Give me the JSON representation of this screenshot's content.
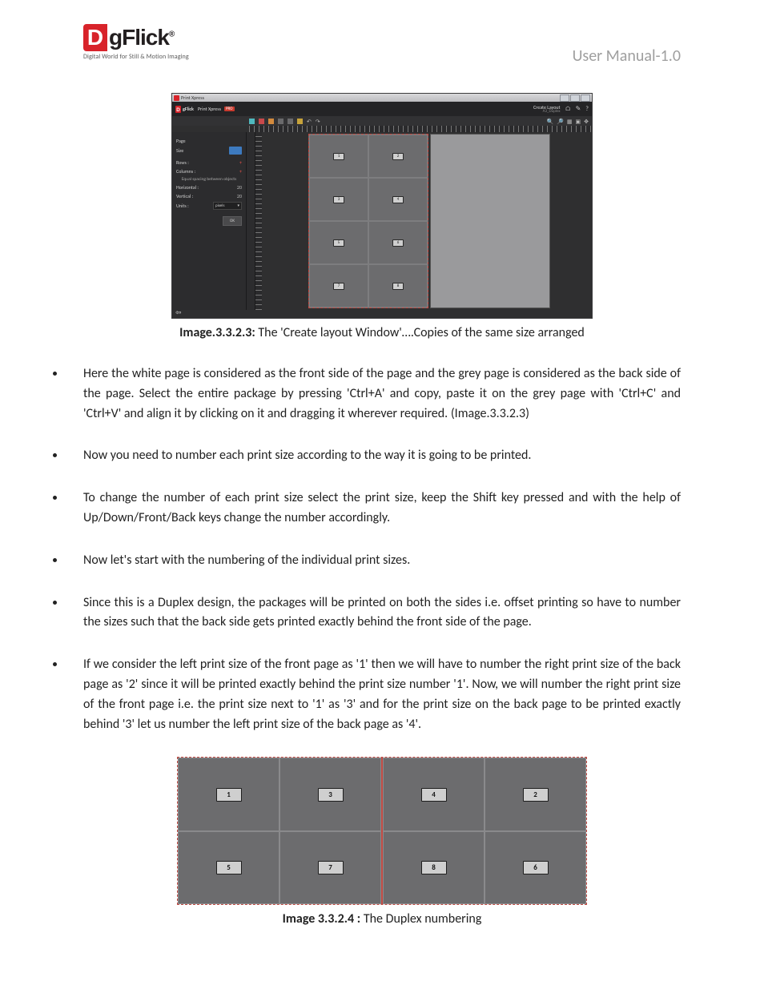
{
  "header": {
    "logo_d": "D",
    "logo_rest": "gFlick",
    "logo_reg": "®",
    "logo_tagline": "Digital World for Still & Motion Imaging",
    "right_text": "User Manual-1.0"
  },
  "fig1": {
    "titlebar_text": "Print Xpress",
    "brand_d": "D",
    "brand_text": "gFlick",
    "product": "Print Xpress",
    "pro_badge": "PRO",
    "create_layout": "Create Layout",
    "layout_name": "A3_Duplex",
    "side": {
      "size_label": "Size",
      "page_label": "Page",
      "rows_label": "Rows :",
      "rows_val": "",
      "cols_label": "Columns :",
      "cols_val": "",
      "spacing_label": "Equal spacing between objects",
      "horiz_label": "Horizontal :",
      "horiz_val": "20",
      "vert_label": "Vertical :",
      "vert_val": "20",
      "units_label": "Units :",
      "units_val": "pixels",
      "ok": "OK"
    },
    "cells": [
      "1",
      "2",
      "3",
      "4",
      "5",
      "6",
      "7",
      "8"
    ],
    "caption_b": "Image.3.3.2.3:",
    "caption_rest": " The 'Create layout Window'….Copies of the same size arranged"
  },
  "bullets": [
    "Here the white page is considered as the front side of the page and the grey page is considered as the back side of the page. Select the entire package by pressing 'Ctrl+A' and copy, paste it on the grey page with 'Ctrl+C' and 'Ctrl+V' and align it by clicking on it and dragging it wherever required. (Image.3.3.2.3)",
    "Now you need to number each print size according to the way it is going to be printed.",
    "To change the number of each print size select the print size, keep the Shift key pressed and with the help of Up/Down/Front/Back keys change the number accordingly.",
    "Now let's start with the numbering of the individual print sizes.",
    "Since this is a Duplex design, the packages will be printed on both the sides i.e. offset printing so have to number the sizes such  that the back side gets printed exactly behind the front side of the page.",
    "If we consider the left print size of the front page as '1' then we will have to number the right print size of the back page as '2' since it will be printed exactly behind the print size number '1'. Now, we will number the right print size of the front page i.e. the print size next to '1' as '3' and for the print size on the back page to be printed exactly behind '3' let us number the left print size of the back page as '4'."
  ],
  "fig2": {
    "left": [
      "1",
      "3",
      "5",
      "7"
    ],
    "right": [
      "4",
      "2",
      "8",
      "6"
    ],
    "caption_b": "Image 3.3.2.4 :",
    "caption_rest": " The Duplex numbering"
  }
}
